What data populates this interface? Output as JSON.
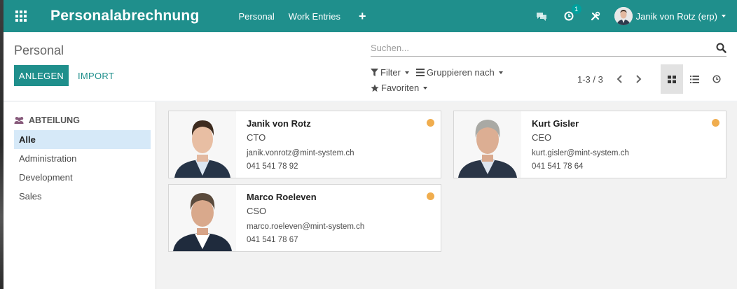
{
  "colors": {
    "brand": "#1f8f8c",
    "status_away": "#f0ad4e",
    "active_filter": "#d6e9f8"
  },
  "navbar": {
    "title": "Personalabrechnung",
    "menu": [
      "Personal",
      "Work Entries"
    ],
    "plus": "+",
    "activity_badge": "1",
    "user_name": "Janik von Rotz (erp)"
  },
  "control": {
    "breadcrumb": "Personal",
    "create_label": "ANLEGEN",
    "import_label": "IMPORT",
    "search_placeholder": "Suchen...",
    "filter_label": "Filter",
    "group_label": "Gruppieren nach",
    "favorites_label": "Favoriten",
    "pager": "1-3 / 3"
  },
  "sidebar": {
    "header": "ABTEILUNG",
    "items": [
      {
        "label": "Alle",
        "active": true
      },
      {
        "label": "Administration",
        "active": false
      },
      {
        "label": "Development",
        "active": false
      },
      {
        "label": "Sales",
        "active": false
      }
    ]
  },
  "employees": [
    {
      "name": "Janik von Rotz",
      "job": "CTO",
      "email": "janik.vonrotz@mint-system.ch",
      "phone": "041 541 78 92",
      "status": "away"
    },
    {
      "name": "Kurt Gisler",
      "job": "CEO",
      "email": "kurt.gisler@mint-system.ch",
      "phone": "041 541 78 64",
      "status": "away"
    },
    {
      "name": "Marco Roeleven",
      "job": "CSO",
      "email": "marco.roeleven@mint-system.ch",
      "phone": "041 541 78 67",
      "status": "away"
    }
  ]
}
